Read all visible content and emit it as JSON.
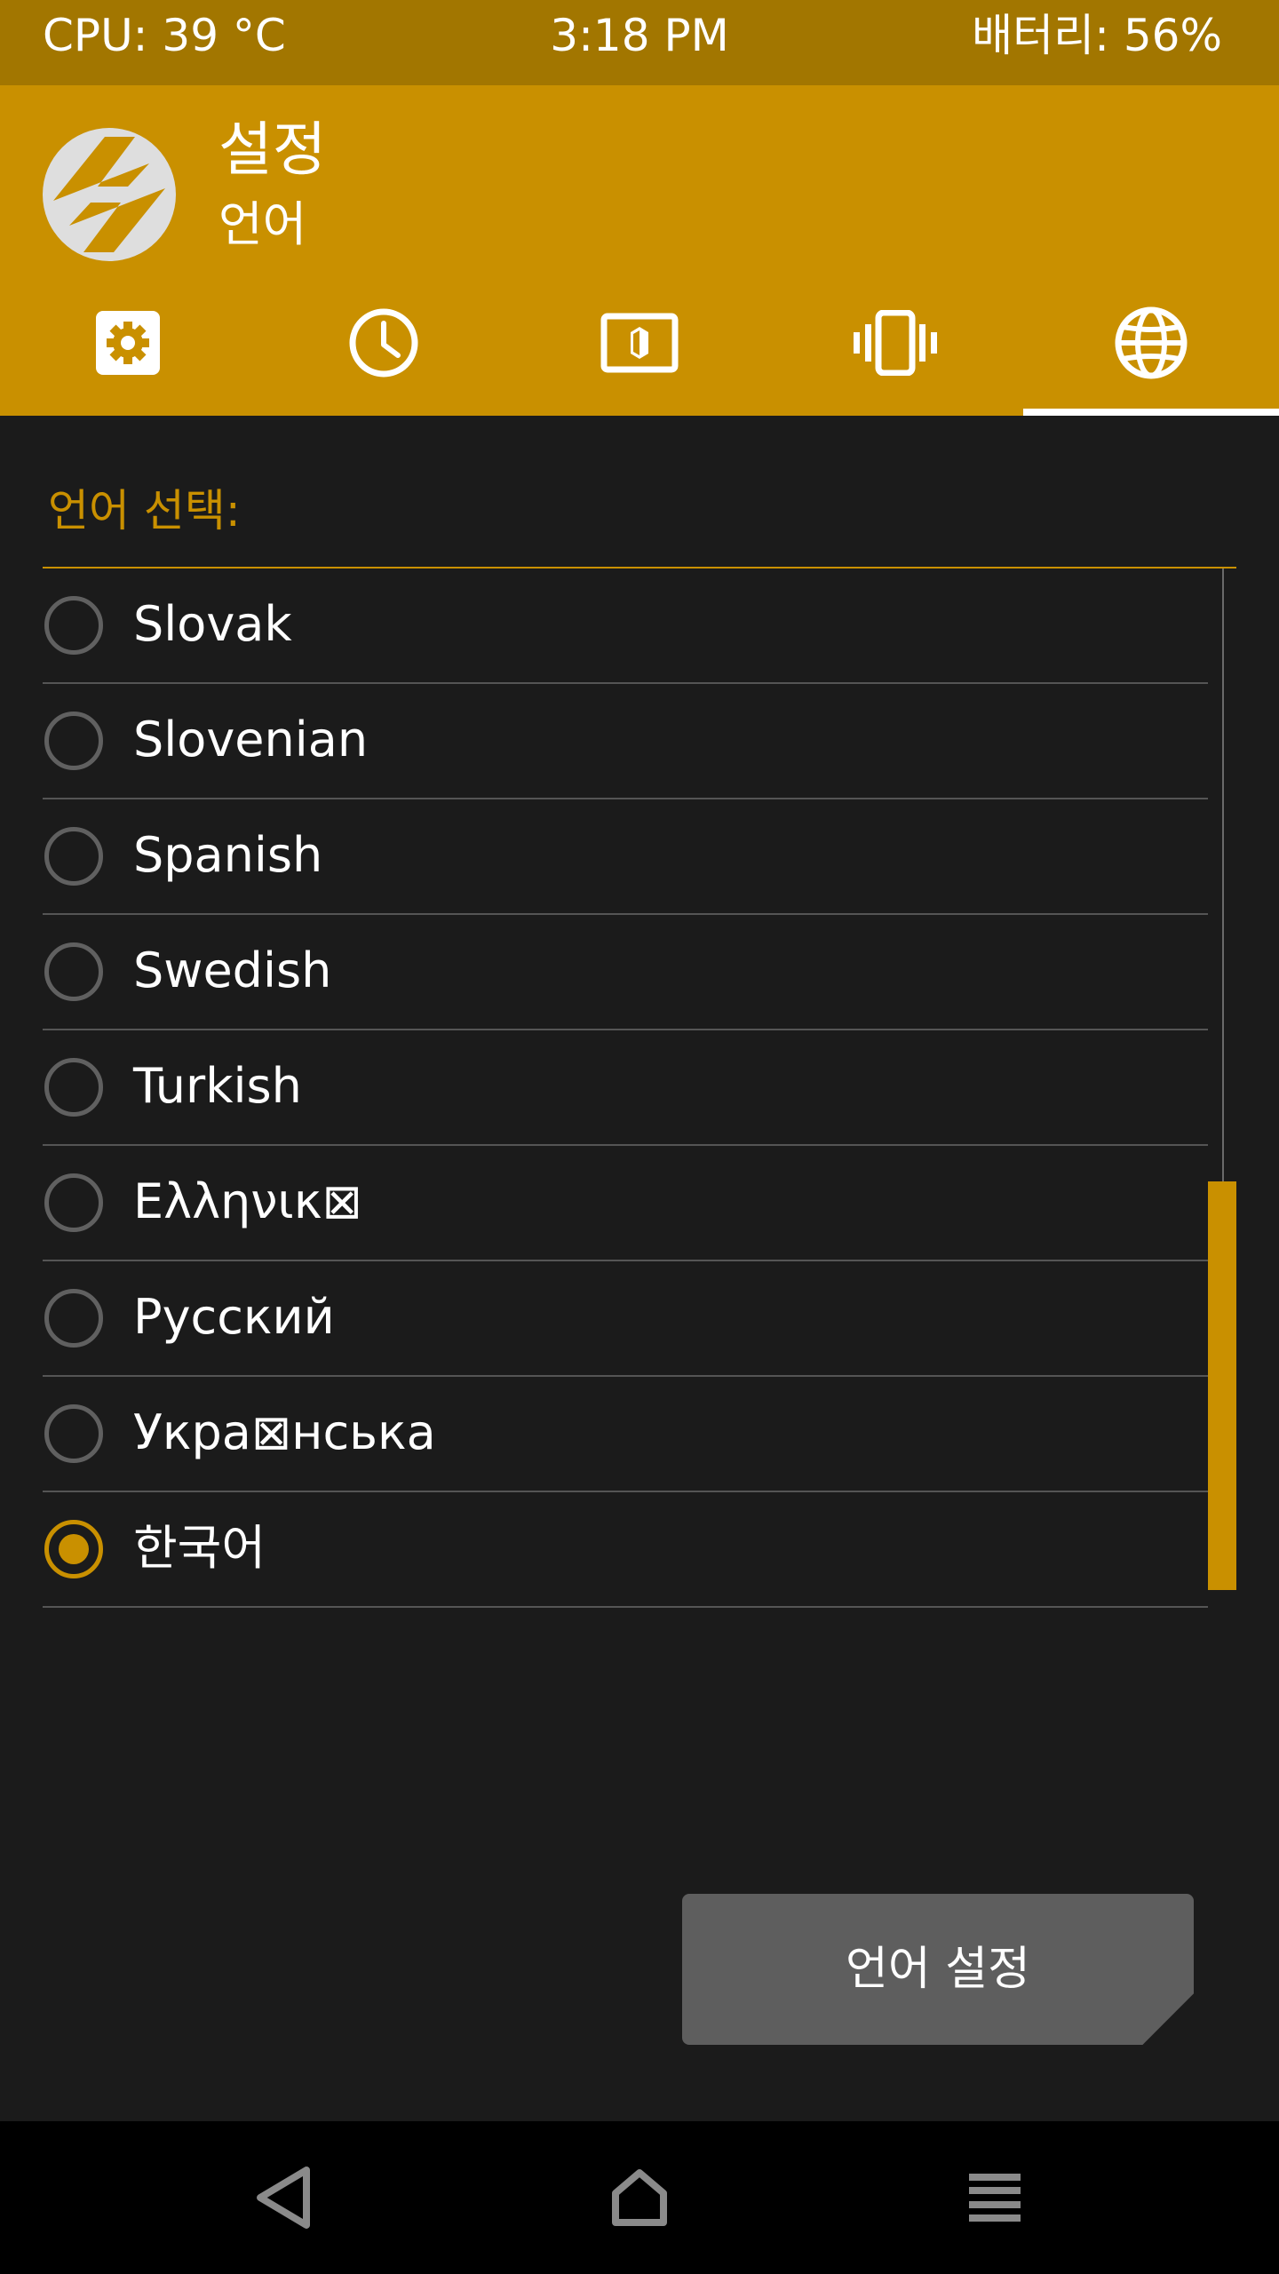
{
  "status_bar": {
    "cpu": "CPU: 39 °C",
    "time": "3:18 PM",
    "battery": "배터리: 56%"
  },
  "header": {
    "title": "설정",
    "subtitle": "언어",
    "logo_icon": "twrp-logo-icon",
    "tabs": [
      {
        "icon": "gear-icon",
        "selected": false
      },
      {
        "icon": "clock-icon",
        "selected": false
      },
      {
        "icon": "brightness-icon",
        "selected": false
      },
      {
        "icon": "vibration-icon",
        "selected": false
      },
      {
        "icon": "globe-icon",
        "selected": true
      }
    ]
  },
  "language_section": {
    "label": "언어 선택:",
    "items": [
      {
        "label": "Slovak",
        "selected": false
      },
      {
        "label": "Slovenian",
        "selected": false
      },
      {
        "label": "Spanish",
        "selected": false
      },
      {
        "label": "Swedish",
        "selected": false
      },
      {
        "label": "Turkish",
        "selected": false
      },
      {
        "label": "Ελληνικ⊠",
        "selected": false
      },
      {
        "label": "Русский",
        "selected": false
      },
      {
        "label": "Укра⊠нська",
        "selected": false
      },
      {
        "label": "한국어",
        "selected": true
      }
    ]
  },
  "action": {
    "set_language_label": "언어 설정"
  },
  "nav": {
    "back_icon": "back-triangle-icon",
    "home_icon": "home-icon",
    "menu_icon": "menu-lines-icon"
  },
  "colors": {
    "accent": "#c99000",
    "status_bar": "#a27600",
    "background": "#1b1b1b",
    "button": "#5e5e5e"
  }
}
